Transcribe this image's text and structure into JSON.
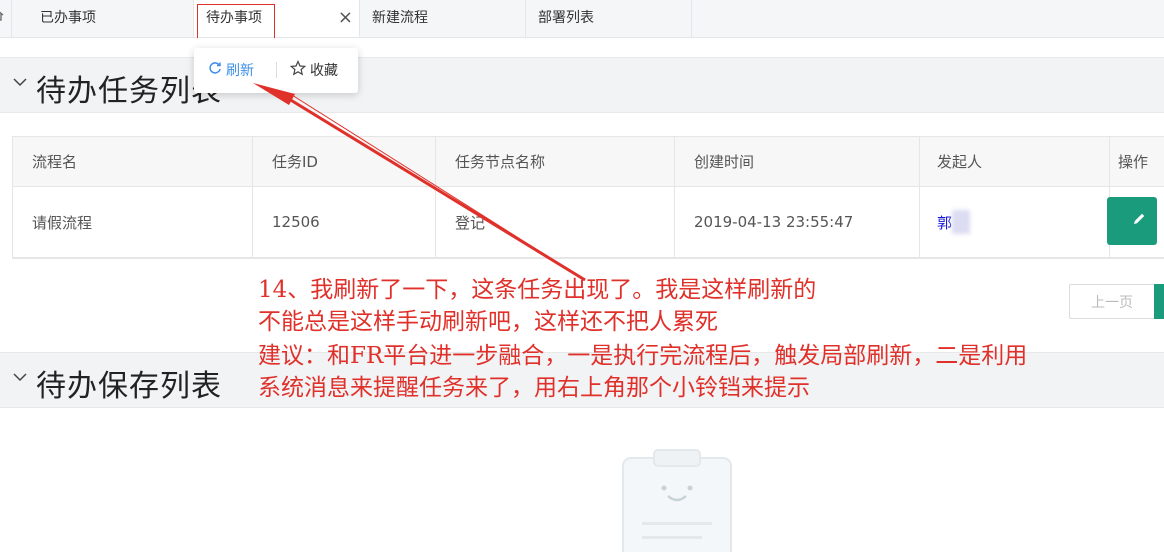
{
  "tabs": [
    {
      "label": "已办事项"
    },
    {
      "label": "待办事项"
    },
    {
      "label": "新建流程"
    },
    {
      "label": "部署列表"
    }
  ],
  "tab_close_glyph": "×",
  "popover": {
    "refresh_label": "刷新",
    "favorite_label": "收藏"
  },
  "sections": {
    "todo_tasks_title": "待办任务列表",
    "todo_saved_title": "待办保存列表"
  },
  "table": {
    "headers": [
      "流程名",
      "任务ID",
      "任务节点名称",
      "创建时间",
      "发起人",
      "操作"
    ],
    "rows": [
      {
        "process_name": "请假流程",
        "task_id": "12506",
        "node_name": "登记",
        "created_at": "2019-04-13 23:55:47",
        "initiator": "郭"
      }
    ]
  },
  "pagination": {
    "prev_label": "上一页"
  },
  "annotation": {
    "line1": "14、我刷新了一下，这条任务出现了。我是这样刷新的",
    "line2": "不能总是这样手动刷新吧，这样还不把人累死",
    "line3": "建议：和FR平台进一步融合，一是执行完流程后，触发局部刷新，二是利用",
    "line4": "系统消息来提醒任务来了，用右上角那个小铃铛来提示"
  },
  "colors": {
    "accent_green": "#1a9b7b",
    "annotation_red": "#e0302a",
    "refresh_blue": "#3d8ee8"
  },
  "icons": {
    "home": "home-icon",
    "close": "close-icon",
    "refresh": "refresh-icon",
    "star": "star-icon",
    "chevron": "chevron-down-icon",
    "edit": "pencil-icon",
    "empty": "empty-clipboard-icon"
  }
}
